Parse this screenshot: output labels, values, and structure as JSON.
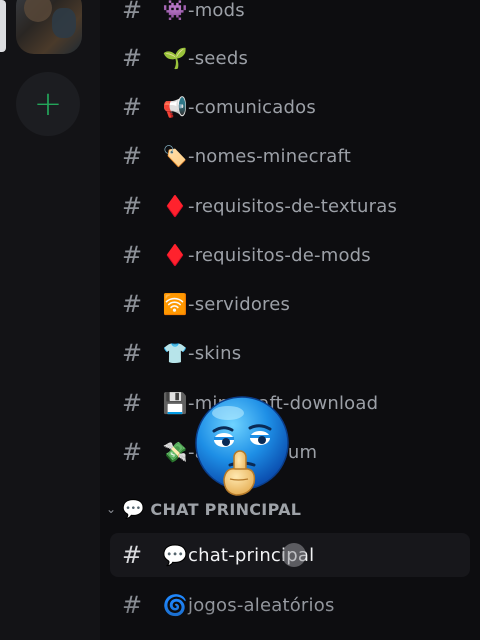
{
  "server_rail": {
    "add_server_glyph": "+",
    "accent_color": "#23a55a"
  },
  "channels": [
    {
      "hash": "#",
      "emoji": "👾",
      "name": "-mods"
    },
    {
      "hash": "#",
      "emoji": "🌱",
      "name": "-seeds"
    },
    {
      "hash": "#",
      "emoji": "📢",
      "name": "-comunicados"
    },
    {
      "hash": "#",
      "emoji": "🏷️",
      "name": "-nomes-minecraft"
    },
    {
      "hash": "#",
      "emoji": "♦️",
      "name": "-requisitos-de-texturas"
    },
    {
      "hash": "#",
      "emoji": "♦️",
      "name": "-requisitos-de-mods"
    },
    {
      "hash": "#",
      "emoji": "🛜",
      "name": "-servidores"
    },
    {
      "hash": "#",
      "emoji": "👕",
      "name": "-skins"
    },
    {
      "hash": "#",
      "emoji": "💾",
      "name": "-minecraft-download"
    },
    {
      "hash": "#",
      "emoji": "💸",
      "name": "-apk-premium"
    }
  ],
  "category": {
    "chevron": "⌄",
    "emoji": "💬",
    "name": "CHAT PRINCIPAL"
  },
  "category_channels": [
    {
      "hash": "#",
      "emoji": "💬",
      "name": "chat-principal",
      "active": true
    },
    {
      "hash": "#",
      "emoji": "🌀",
      "name": "jogos-aleatórios",
      "active": false
    }
  ]
}
